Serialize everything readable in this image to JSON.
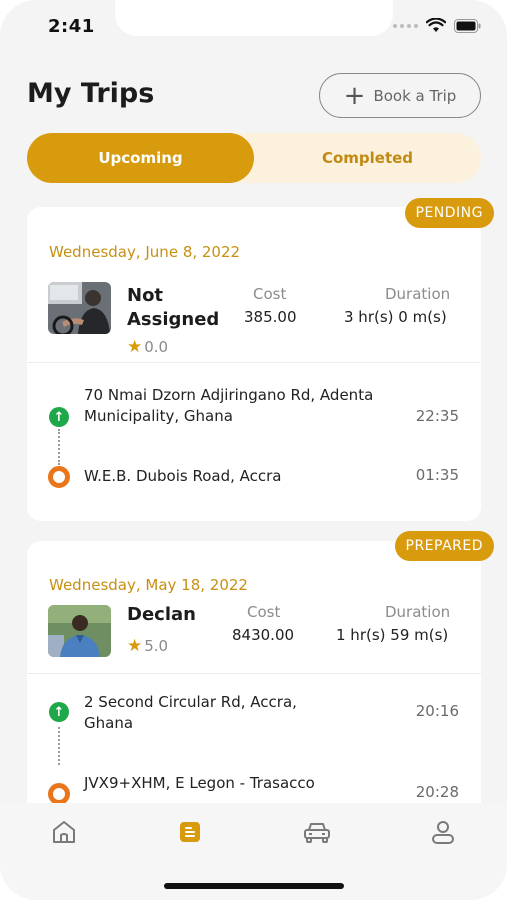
{
  "status_bar": {
    "time": "2:41"
  },
  "header": {
    "title": "My Trips",
    "book_button": "Book a Trip"
  },
  "tabs": [
    {
      "label": "Upcoming",
      "active": true
    },
    {
      "label": "Completed",
      "active": false
    }
  ],
  "labels": {
    "cost": "Cost",
    "duration": "Duration"
  },
  "trips": [
    {
      "status": "PENDING",
      "date": "Wednesday, June 8, 2022",
      "driver_name": "Not Assigned",
      "rating": "0.0",
      "cost": "385.00",
      "duration": "3 hr(s) 0 m(s)",
      "pickup_address": "70 Nmai Dzorn Adjiringano Rd, Adenta Municipality, Ghana",
      "pickup_time": "22:35",
      "dropoff_address": "W.E.B. Dubois Road, Accra",
      "dropoff_time": "01:35"
    },
    {
      "status": "PREPARED",
      "date": "Wednesday, May 18, 2022",
      "driver_name": "Declan",
      "rating": "5.0",
      "cost": "8430.00",
      "duration": "1 hr(s) 59 m(s)",
      "pickup_address": "2 Second Circular Rd, Accra, Ghana",
      "pickup_time": "20:16",
      "dropoff_address": "JVX9+XHM, E Legon - Trasacco",
      "dropoff_time": "20:28"
    }
  ],
  "nav": [
    {
      "icon": "home-icon",
      "active": false
    },
    {
      "icon": "trips-icon",
      "active": true
    },
    {
      "icon": "car-icon",
      "active": false
    },
    {
      "icon": "profile-icon",
      "active": false
    }
  ],
  "colors": {
    "accent": "#d99b0e",
    "tab_bg": "#fbf1dc",
    "pickup": "#1fa84a",
    "dropoff": "#e9761b",
    "date": "#c69013"
  }
}
